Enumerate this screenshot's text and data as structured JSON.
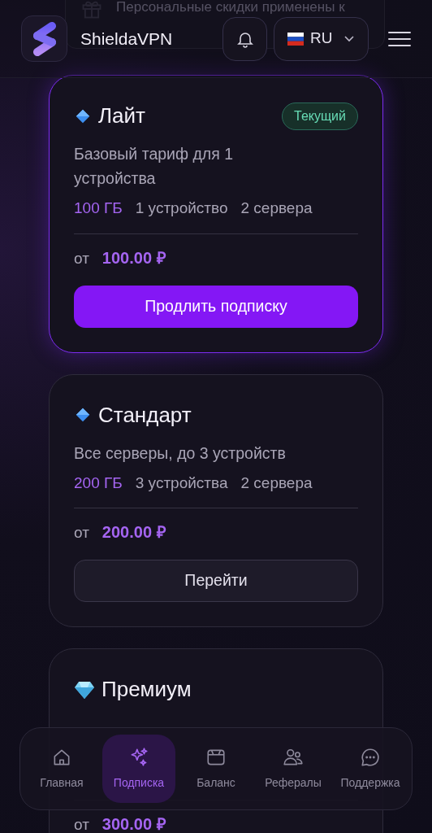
{
  "notice": {
    "text": "Персональные скидки применены к"
  },
  "header": {
    "brand": "ShieldaVPN",
    "language": "RU"
  },
  "plans": [
    {
      "kind": "diamond",
      "name": "Лайт",
      "current": true,
      "badge": "Текущий",
      "description": "Базовый тариф для 1 устройства",
      "features": [
        "100 ГБ",
        "1 устройство",
        "2 сервера"
      ],
      "price_prefix": "от",
      "price": "100.00 ₽",
      "action": "Продлить подписку"
    },
    {
      "kind": "diamond",
      "name": "Стандарт",
      "current": false,
      "description": "Все серверы, до 3 устройств",
      "features": [
        "200 ГБ",
        "3 устройства",
        "2 сервера"
      ],
      "price_prefix": "от",
      "price": "200.00 ₽",
      "action": "Перейти"
    },
    {
      "kind": "gem",
      "name": "Премиум",
      "current": false,
      "price_prefix": "от",
      "price": "300.00 ₽"
    }
  ],
  "nav": [
    {
      "label": "Главная",
      "selected": false
    },
    {
      "label": "Подписка",
      "selected": true
    },
    {
      "label": "Баланс",
      "selected": false
    },
    {
      "label": "Рефералы",
      "selected": false
    },
    {
      "label": "Поддержка",
      "selected": false
    }
  ]
}
